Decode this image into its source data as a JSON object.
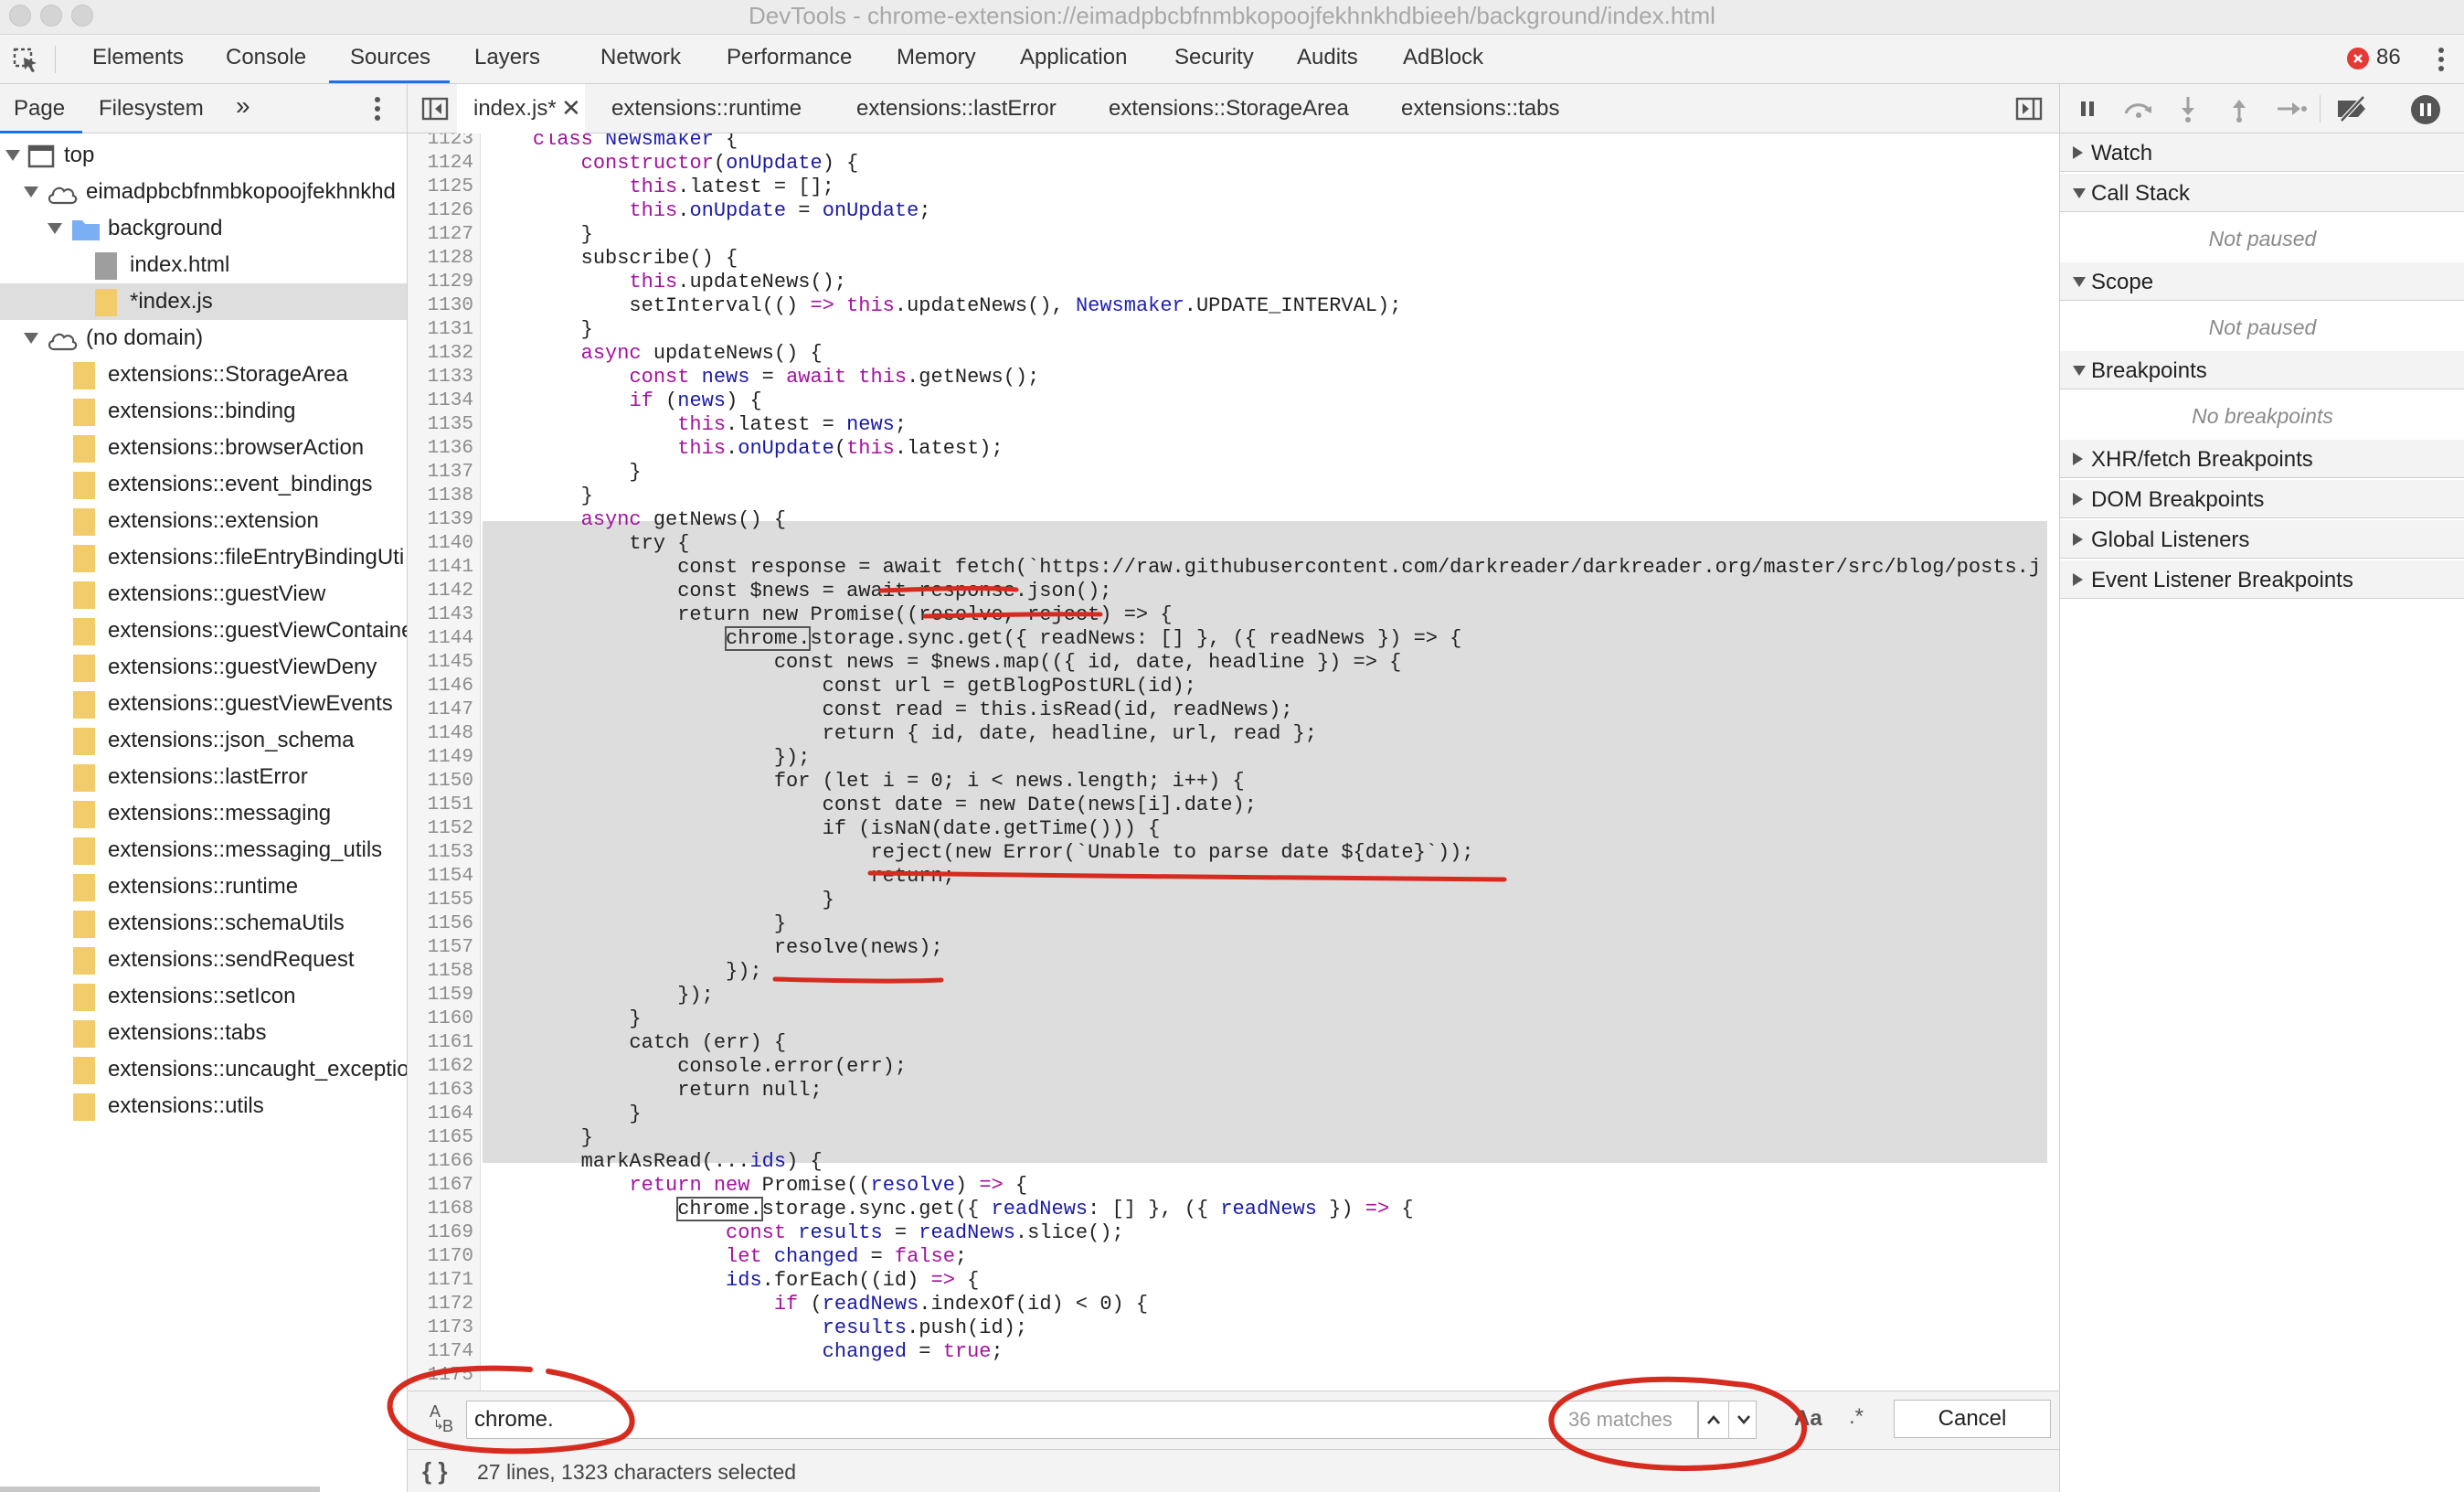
{
  "window": {
    "title": "DevTools - chrome-extension://eimadpbcbfnmbkopoojfekhnkhdbieeh/background/index.html"
  },
  "toolbar": {
    "tabs": [
      "Elements",
      "Console",
      "Sources",
      "Layers",
      "Network",
      "Performance",
      "Memory",
      "Application",
      "Security",
      "Audits",
      "AdBlock"
    ],
    "active_tab": "Sources",
    "error_count": "86"
  },
  "navigator": {
    "tabs": [
      "Page",
      "Filesystem"
    ],
    "more": "»",
    "tree": [
      {
        "label": "top",
        "type": "frame"
      },
      {
        "label": "eimadpbcbfnmbkopoojfekhnkhd",
        "type": "cloud"
      },
      {
        "label": "background",
        "type": "folder"
      },
      {
        "label": "index.html",
        "type": "file-gray"
      },
      {
        "label": "*index.js",
        "type": "file",
        "selected": true
      },
      {
        "label": "(no domain)",
        "type": "cloud"
      },
      {
        "label": "extensions::StorageArea",
        "type": "file"
      },
      {
        "label": "extensions::binding",
        "type": "file"
      },
      {
        "label": "extensions::browserAction",
        "type": "file"
      },
      {
        "label": "extensions::event_bindings",
        "type": "file"
      },
      {
        "label": "extensions::extension",
        "type": "file"
      },
      {
        "label": "extensions::fileEntryBindingUti",
        "type": "file"
      },
      {
        "label": "extensions::guestView",
        "type": "file"
      },
      {
        "label": "extensions::guestViewContaine",
        "type": "file"
      },
      {
        "label": "extensions::guestViewDeny",
        "type": "file"
      },
      {
        "label": "extensions::guestViewEvents",
        "type": "file"
      },
      {
        "label": "extensions::json_schema",
        "type": "file"
      },
      {
        "label": "extensions::lastError",
        "type": "file"
      },
      {
        "label": "extensions::messaging",
        "type": "file"
      },
      {
        "label": "extensions::messaging_utils",
        "type": "file"
      },
      {
        "label": "extensions::runtime",
        "type": "file"
      },
      {
        "label": "extensions::schemaUtils",
        "type": "file"
      },
      {
        "label": "extensions::sendRequest",
        "type": "file"
      },
      {
        "label": "extensions::setIcon",
        "type": "file"
      },
      {
        "label": "extensions::tabs",
        "type": "file"
      },
      {
        "label": "extensions::uncaught_exceptio",
        "type": "file"
      },
      {
        "label": "extensions::utils",
        "type": "file"
      }
    ]
  },
  "editor": {
    "tabs": [
      {
        "label": "index.js*",
        "active": true,
        "closable": true
      },
      {
        "label": "extensions::runtime"
      },
      {
        "label": "extensions::lastError"
      },
      {
        "label": "extensions::StorageArea"
      },
      {
        "label": "extensions::tabs"
      }
    ],
    "lines": [
      {
        "n": "1123",
        "code": "    class Newsmaker {"
      },
      {
        "n": "1124",
        "code": "        constructor(onUpdate) {"
      },
      {
        "n": "1125",
        "code": "            this.latest = [];"
      },
      {
        "n": "1126",
        "code": "            this.onUpdate = onUpdate;"
      },
      {
        "n": "1127",
        "code": "        }"
      },
      {
        "n": "1128",
        "code": "        subscribe() {"
      },
      {
        "n": "1129",
        "code": "            this.updateNews();"
      },
      {
        "n": "1130",
        "code": "            setInterval(() => this.updateNews(), Newsmaker.UPDATE_INTERVAL);"
      },
      {
        "n": "1131",
        "code": "        }"
      },
      {
        "n": "1132",
        "code": "        async updateNews() {"
      },
      {
        "n": "1133",
        "code": "            const news = await this.getNews();"
      },
      {
        "n": "1134",
        "code": "            if (news) {"
      },
      {
        "n": "1135",
        "code": "                this.latest = news;"
      },
      {
        "n": "1136",
        "code": "                this.onUpdate(this.latest);"
      },
      {
        "n": "1137",
        "code": "            }"
      },
      {
        "n": "1138",
        "code": "        }"
      },
      {
        "n": "1139",
        "code": "        async getNews() {"
      },
      {
        "n": "1140",
        "code": "            try {"
      },
      {
        "n": "1141",
        "code": "                const response = await fetch(`https://raw.githubusercontent.com/darkreader/darkreader.org/master/src/blog/posts.j"
      },
      {
        "n": "1142",
        "code": "                const $news = await response.json();"
      },
      {
        "n": "1143",
        "code": "                return new Promise((resolve, reject) => {"
      },
      {
        "n": "1144",
        "code": "                    chrome.storage.sync.get({ readNews: [] }, ({ readNews }) => {"
      },
      {
        "n": "1145",
        "code": "                        const news = $news.map(({ id, date, headline }) => {"
      },
      {
        "n": "1146",
        "code": "                            const url = getBlogPostURL(id);"
      },
      {
        "n": "1147",
        "code": "                            const read = this.isRead(id, readNews);"
      },
      {
        "n": "1148",
        "code": "                            return { id, date, headline, url, read };"
      },
      {
        "n": "1149",
        "code": "                        });"
      },
      {
        "n": "1150",
        "code": "                        for (let i = 0; i < news.length; i++) {"
      },
      {
        "n": "1151",
        "code": "                            const date = new Date(news[i].date);"
      },
      {
        "n": "1152",
        "code": "                            if (isNaN(date.getTime())) {"
      },
      {
        "n": "1153",
        "code": "                                reject(new Error(`Unable to parse date ${date}`));"
      },
      {
        "n": "1154",
        "code": "                                return;"
      },
      {
        "n": "1155",
        "code": "                            }"
      },
      {
        "n": "1156",
        "code": "                        }"
      },
      {
        "n": "1157",
        "code": "                        resolve(news);"
      },
      {
        "n": "1158",
        "code": "                    });"
      },
      {
        "n": "1159",
        "code": "                });"
      },
      {
        "n": "1160",
        "code": "            }"
      },
      {
        "n": "1161",
        "code": "            catch (err) {"
      },
      {
        "n": "1162",
        "code": "                console.error(err);"
      },
      {
        "n": "1163",
        "code": "                return null;"
      },
      {
        "n": "1164",
        "code": "            }"
      },
      {
        "n": "1165",
        "code": "        }"
      },
      {
        "n": "1166",
        "code": "        markAsRead(...ids) {"
      },
      {
        "n": "1167",
        "code": "            return new Promise((resolve) => {"
      },
      {
        "n": "1168",
        "code": "                chrome.storage.sync.get({ readNews: [] }, ({ readNews }) => {"
      },
      {
        "n": "1169",
        "code": "                    const results = readNews.slice();"
      },
      {
        "n": "1170",
        "code": "                    let changed = false;"
      },
      {
        "n": "1171",
        "code": "                    ids.forEach((id) => {"
      },
      {
        "n": "1172",
        "code": "                        if (readNews.indexOf(id) < 0) {"
      },
      {
        "n": "1173",
        "code": "                            results.push(id);"
      },
      {
        "n": "1174",
        "code": "                            changed = true;"
      },
      {
        "n": "1175",
        "code": ""
      }
    ]
  },
  "search": {
    "value": "chrome.",
    "matches": "36 matches",
    "case_label": "Aa",
    "regex_label": ".*",
    "cancel_label": "Cancel"
  },
  "status": {
    "pretty_print": "{ }",
    "text": "27 lines, 1323 characters selected"
  },
  "debugger": {
    "panes": [
      {
        "label": "Watch",
        "open": false
      },
      {
        "label": "Call Stack",
        "open": true,
        "empty": "Not paused"
      },
      {
        "label": "Scope",
        "open": true,
        "empty": "Not paused"
      },
      {
        "label": "Breakpoints",
        "open": true,
        "empty": "No breakpoints"
      },
      {
        "label": "XHR/fetch Breakpoints",
        "open": false
      },
      {
        "label": "DOM Breakpoints",
        "open": false
      },
      {
        "label": "Global Listeners",
        "open": false
      },
      {
        "label": "Event Listener Breakpoints",
        "open": false
      }
    ]
  },
  "colors": {
    "accent": "#1a73e8",
    "error": "#e53935",
    "annotation": "#d62b1f",
    "keyword": "#a4129e",
    "variable": "#1a1aa6"
  }
}
